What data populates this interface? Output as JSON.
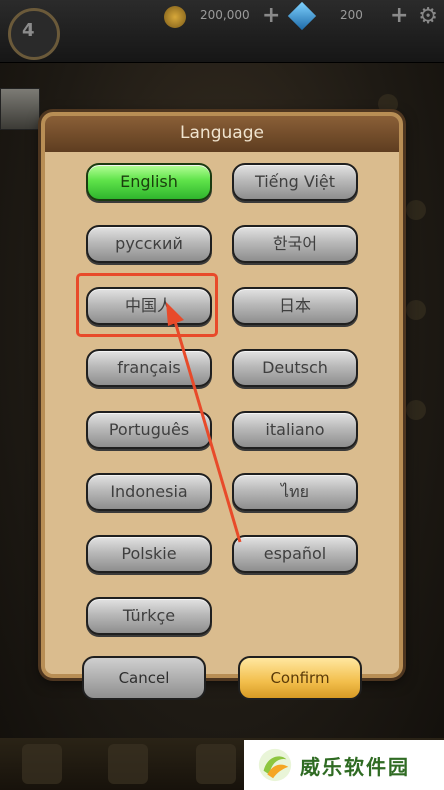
{
  "hud": {
    "avatar_level": "4",
    "gold_amount": "200,000",
    "gem_amount": "200"
  },
  "dialog": {
    "title": "Language",
    "languages": [
      {
        "label": "English",
        "selected": true
      },
      {
        "label": "Tiếng Việt",
        "selected": false
      },
      {
        "label": "русский",
        "selected": false
      },
      {
        "label": "한국어",
        "selected": false
      },
      {
        "label": "中国人",
        "selected": false
      },
      {
        "label": "日本",
        "selected": false
      },
      {
        "label": "français",
        "selected": false
      },
      {
        "label": "Deutsch",
        "selected": false
      },
      {
        "label": "Português",
        "selected": false
      },
      {
        "label": "italiano",
        "selected": false
      },
      {
        "label": "Indonesia",
        "selected": false
      },
      {
        "label": "ไทย",
        "selected": false
      },
      {
        "label": "Polskie",
        "selected": false
      },
      {
        "label": "español",
        "selected": false
      },
      {
        "label": "Türkçe",
        "selected": false
      }
    ],
    "cancel_label": "Cancel",
    "confirm_label": "Confirm"
  },
  "annotation": {
    "highlight_color": "#e84a2a"
  },
  "watermark": {
    "text": "威乐软件园"
  },
  "colors": {
    "selected_button": "#5fe34a",
    "default_button": "#b9b9b9",
    "confirm_button": "#f2be4b",
    "dialog_panel": "#dabc8e",
    "dialog_header": "#6e4a2a"
  }
}
